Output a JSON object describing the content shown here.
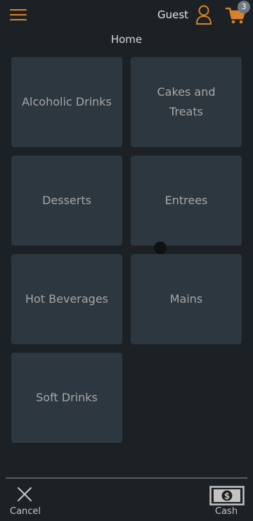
{
  "header": {
    "user_label": "Guest",
    "cart_count": "3"
  },
  "page": {
    "title": "Home"
  },
  "categories": [
    {
      "label": "Alcoholic Drinks"
    },
    {
      "label": "Cakes and Treats"
    },
    {
      "label": "Desserts"
    },
    {
      "label": "Entrees"
    },
    {
      "label": "Hot Beverages"
    },
    {
      "label": "Mains"
    },
    {
      "label": "Soft Drinks"
    }
  ],
  "footer": {
    "cancel_label": "Cancel",
    "cash_label": "Cash"
  },
  "colors": {
    "accent": "#d9822b",
    "background": "#1c2126",
    "tile": "#2c3740"
  },
  "icons": {
    "menu": "hamburger-menu-icon",
    "user": "user-icon",
    "cart": "shopping-cart-icon",
    "cancel": "close-icon",
    "cash": "cash-icon"
  }
}
